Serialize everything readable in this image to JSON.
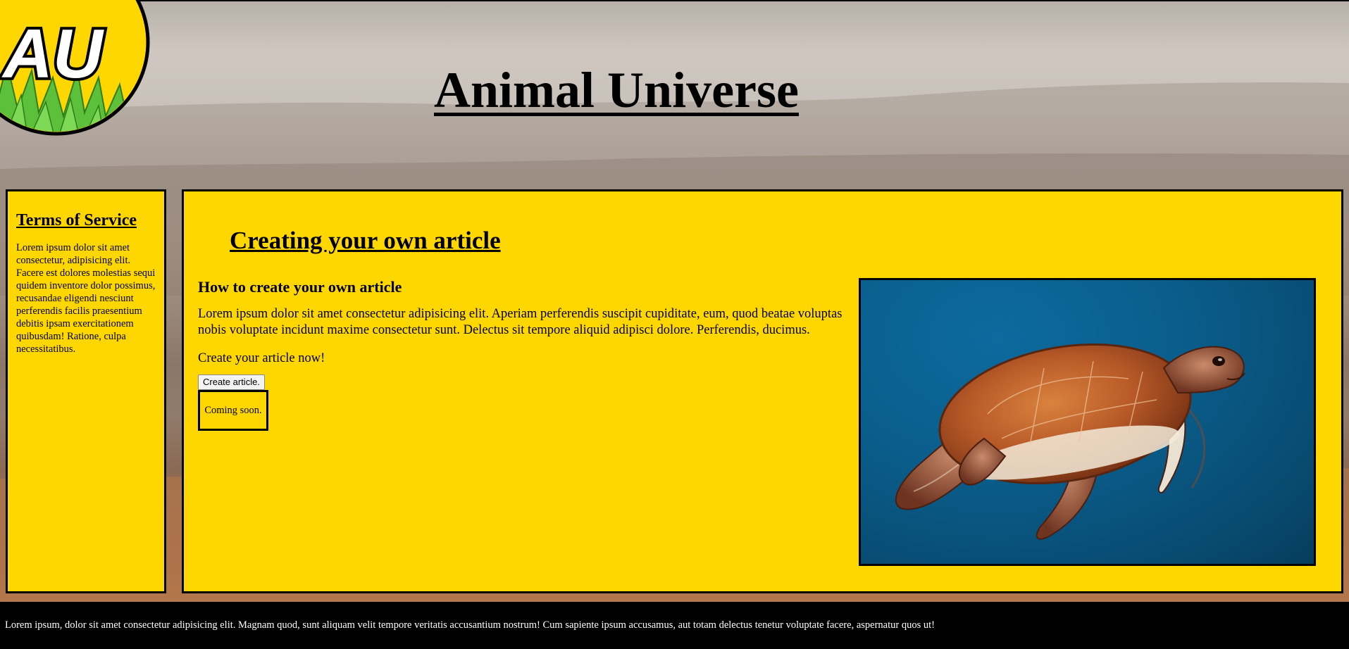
{
  "site": {
    "title": "Animal Universe",
    "logo_text": "AU"
  },
  "sidebar": {
    "heading": "Terms of Service",
    "body": "Lorem ipsum dolor sit amet consectetur, adipisicing elit. Facere est dolores molestias sequi quidem inventore dolor possimus, recusandae eligendi nesciunt perferendis facilis praesentium debitis ipsam exercitationem quibusdam! Ratione, culpa necessitatibus."
  },
  "main": {
    "heading": "Creating your own article",
    "subheading": "How to create your own article",
    "body": "Lorem ipsum dolor sit amet consectetur adipisicing elit. Aperiam perferendis suscipit cupiditate, eum, quod beatae voluptas nobis voluptate incidunt maxime consectetur sunt. Delectus sit tempore aliquid adipisci dolore. Perferendis, ducimus.",
    "cta_text": "Create your article now!",
    "create_button_label": "Create article.",
    "coming_soon_text": "Coming soon.",
    "image_subject": "sea-turtle"
  },
  "footer": {
    "text": "Lorem ipsum, dolor sit amet consectetur adipisicing elit. Magnam quod, sunt aliquam velit tempore veritatis accusantium nostrum! Cum sapiente ipsum accusamus, aut totam delectus tenetur voluptate facere, aspernatur quos ut!"
  },
  "colors": {
    "panel_background": "#ffd700",
    "border": "#000000",
    "footer_background": "#000000",
    "footer_text": "#ffffff",
    "logo_background": "#ffd700",
    "logo_grass": "#5cc03a"
  }
}
